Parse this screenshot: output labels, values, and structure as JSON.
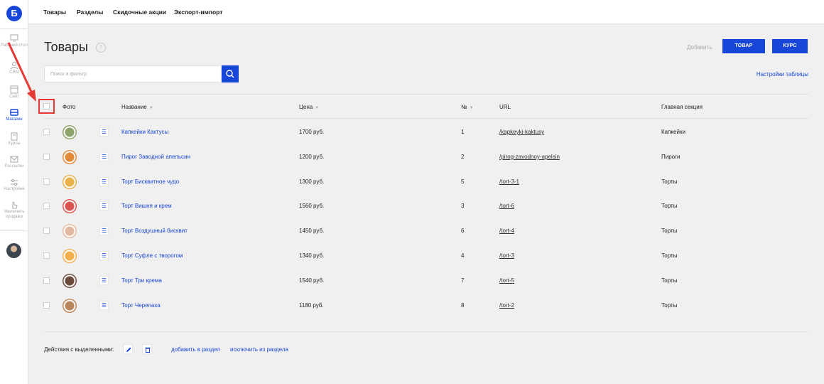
{
  "app": {
    "logo_letter": "Б"
  },
  "rail": [
    {
      "id": "dashboard",
      "label": "Рабочий стол",
      "icon": "monitor-icon",
      "active": false
    },
    {
      "id": "crm",
      "label": "CRM",
      "icon": "crm-icon",
      "active": false
    },
    {
      "id": "site",
      "label": "Сайт",
      "icon": "site-icon",
      "active": false
    },
    {
      "id": "shop",
      "label": "Магазин",
      "icon": "cart-icon",
      "active": true
    },
    {
      "id": "courses",
      "label": "Курсы",
      "icon": "book-icon",
      "active": false
    },
    {
      "id": "mailing",
      "label": "Рассылки",
      "icon": "envelope-icon",
      "active": false
    },
    {
      "id": "settings",
      "label": "Настройки",
      "icon": "settings-icon",
      "active": false
    },
    {
      "id": "sales",
      "label": "Увеличить продажи",
      "icon": "hand-pointer-icon",
      "active": false
    }
  ],
  "topnav": [
    "Товары",
    "Разделы",
    "Скидочные акции",
    "Экспорт-импорт"
  ],
  "page": {
    "title": "Товары",
    "help": "?",
    "add_label": "Добавить",
    "btn_product": "ТОВАР",
    "btn_course": "КУРС",
    "search_placeholder": "Поиск и фильтр",
    "table_settings": "Настройки таблицы"
  },
  "table": {
    "headers": {
      "photo": "Фото",
      "name": "Название",
      "price": "Цена",
      "num": "№",
      "url": "URL",
      "section": "Главная секция"
    },
    "rows": [
      {
        "name": "Капкейки Кактусы",
        "price": "1700 руб.",
        "num": "1",
        "url": "/kapkeyki-kaktusy",
        "section": "Капкейки",
        "thumb": "#8da46a"
      },
      {
        "name": "Пирог Заводной апельсин",
        "price": "1200 руб.",
        "num": "2",
        "url": "/pirog-zavodnoy-apelsin",
        "section": "Пироги",
        "thumb": "#e08a3a"
      },
      {
        "name": "Торт Бисквитное чудо",
        "price": "1300 руб.",
        "num": "5",
        "url": "/tort-3-1",
        "section": "Торты",
        "thumb": "#e7b04a"
      },
      {
        "name": "Торт Вишня и крем",
        "price": "1560 руб.",
        "num": "3",
        "url": "/tort-6",
        "section": "Торты",
        "thumb": "#d9534f"
      },
      {
        "name": "Торт Воздушный бисквит",
        "price": "1450 руб.",
        "num": "6",
        "url": "/tort-4",
        "section": "Торты",
        "thumb": "#e3b8a0"
      },
      {
        "name": "Торт Суфле с творогом",
        "price": "1340 руб.",
        "num": "4",
        "url": "/tort-3",
        "section": "Торты",
        "thumb": "#f2b04c"
      },
      {
        "name": "Торт Три крема",
        "price": "1540 руб.",
        "num": "7",
        "url": "/tort-5",
        "section": "Торты",
        "thumb": "#6b4a3a"
      },
      {
        "name": "Торт Черепаха",
        "price": "1180 руб.",
        "num": "8",
        "url": "/tort-2",
        "section": "Торты",
        "thumb": "#b9855a"
      }
    ]
  },
  "bulk": {
    "label": "Действия с выделенными:",
    "add_to_section": "добавить в раздел",
    "remove_from_section": "исключить из раздела"
  },
  "colors": {
    "accent": "#1846d8",
    "highlight": "#e53935"
  }
}
